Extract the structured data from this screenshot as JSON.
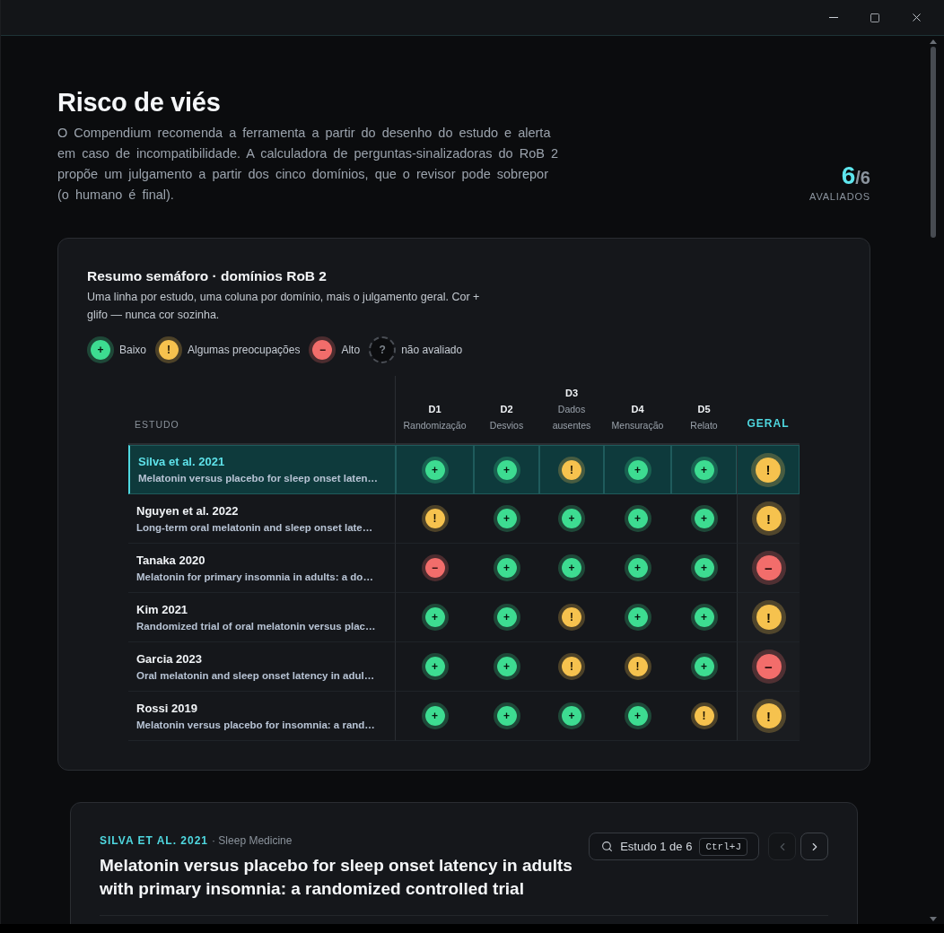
{
  "header": {
    "title": "Risco de viés",
    "description": "O Compendium recomenda a ferramenta a partir do desenho do estudo e alerta em caso de incompatibilidade. A calculadora de perguntas-sinalizadoras do RoB 2 propõe um julgamento a partir dos cinco domínios, que o revisor pode sobrepor (o humano é final).",
    "assessed": "6",
    "total": "/6",
    "assessed_label": "AVALIADOS"
  },
  "summary": {
    "title": "Resumo semáforo · domínios RoB 2",
    "description": "Uma linha por estudo, uma coluna por domínio, mais o julgamento geral. Cor + glifo — nunca cor sozinha.",
    "legend": [
      {
        "kind": "low",
        "glyph": "+",
        "label": "Baixo"
      },
      {
        "kind": "some",
        "glyph": "!",
        "label": "Algumas preocupações"
      },
      {
        "kind": "high",
        "glyph": "−",
        "label": "Alto"
      },
      {
        "kind": "none",
        "glyph": "?",
        "label": "não avaliado"
      }
    ],
    "table": {
      "study_header": "ESTUDO",
      "domains": [
        {
          "code": "D1",
          "name": "Randomização"
        },
        {
          "code": "D2",
          "name": "Desvios"
        },
        {
          "code": "D3",
          "name": "Dados ausentes"
        },
        {
          "code": "D4",
          "name": "Mensuração"
        },
        {
          "code": "D5",
          "name": "Relato"
        }
      ],
      "overall_header": "GERAL",
      "rows": [
        {
          "study": "Silva et al. 2021",
          "title": "Melatonin versus placebo for sleep onset laten…",
          "selected": true,
          "cells": [
            {
              "kind": "low",
              "glyph": "+"
            },
            {
              "kind": "low",
              "glyph": "+"
            },
            {
              "kind": "some",
              "glyph": "!"
            },
            {
              "kind": "low",
              "glyph": "+"
            },
            {
              "kind": "low",
              "glyph": "+"
            }
          ],
          "overall": {
            "kind": "some",
            "glyph": "!"
          }
        },
        {
          "study": "Nguyen et al. 2022",
          "title": "Long-term oral melatonin and sleep onset late…",
          "selected": false,
          "cells": [
            {
              "kind": "some",
              "glyph": "!"
            },
            {
              "kind": "low",
              "glyph": "+"
            },
            {
              "kind": "low",
              "glyph": "+"
            },
            {
              "kind": "low",
              "glyph": "+"
            },
            {
              "kind": "low",
              "glyph": "+"
            }
          ],
          "overall": {
            "kind": "some",
            "glyph": "!"
          }
        },
        {
          "study": "Tanaka 2020",
          "title": "Melatonin for primary insomnia in adults: a do…",
          "selected": false,
          "cells": [
            {
              "kind": "high",
              "glyph": "−"
            },
            {
              "kind": "low",
              "glyph": "+"
            },
            {
              "kind": "low",
              "glyph": "+"
            },
            {
              "kind": "low",
              "glyph": "+"
            },
            {
              "kind": "low",
              "glyph": "+"
            }
          ],
          "overall": {
            "kind": "high",
            "glyph": "−"
          }
        },
        {
          "study": "Kim 2021",
          "title": "Randomized trial of oral melatonin versus plac…",
          "selected": false,
          "cells": [
            {
              "kind": "low",
              "glyph": "+"
            },
            {
              "kind": "low",
              "glyph": "+"
            },
            {
              "kind": "some",
              "glyph": "!"
            },
            {
              "kind": "low",
              "glyph": "+"
            },
            {
              "kind": "low",
              "glyph": "+"
            }
          ],
          "overall": {
            "kind": "some",
            "glyph": "!"
          }
        },
        {
          "study": "Garcia 2023",
          "title": "Oral melatonin and sleep onset latency in adul…",
          "selected": false,
          "cells": [
            {
              "kind": "low",
              "glyph": "+"
            },
            {
              "kind": "low",
              "glyph": "+"
            },
            {
              "kind": "some",
              "glyph": "!"
            },
            {
              "kind": "some",
              "glyph": "!"
            },
            {
              "kind": "low",
              "glyph": "+"
            }
          ],
          "overall": {
            "kind": "high",
            "glyph": "−"
          }
        },
        {
          "study": "Rossi 2019",
          "title": "Melatonin versus placebo for insomnia: a rand…",
          "selected": false,
          "cells": [
            {
              "kind": "low",
              "glyph": "+"
            },
            {
              "kind": "low",
              "glyph": "+"
            },
            {
              "kind": "low",
              "glyph": "+"
            },
            {
              "kind": "low",
              "glyph": "+"
            },
            {
              "kind": "some",
              "glyph": "!"
            }
          ],
          "overall": {
            "kind": "some",
            "glyph": "!"
          }
        }
      ]
    }
  },
  "detail": {
    "citation": "SILVA ET AL. 2021",
    "journal": "· Sleep Medicine",
    "title": "Melatonin versus placebo for sleep onset latency in adults with primary insomnia: a randomized controlled trial",
    "navigator": {
      "label": "Estudo 1 de 6",
      "shortcut": "Ctrl+J"
    },
    "previous": {
      "disabled": true
    },
    "next": {
      "disabled": false
    }
  }
}
